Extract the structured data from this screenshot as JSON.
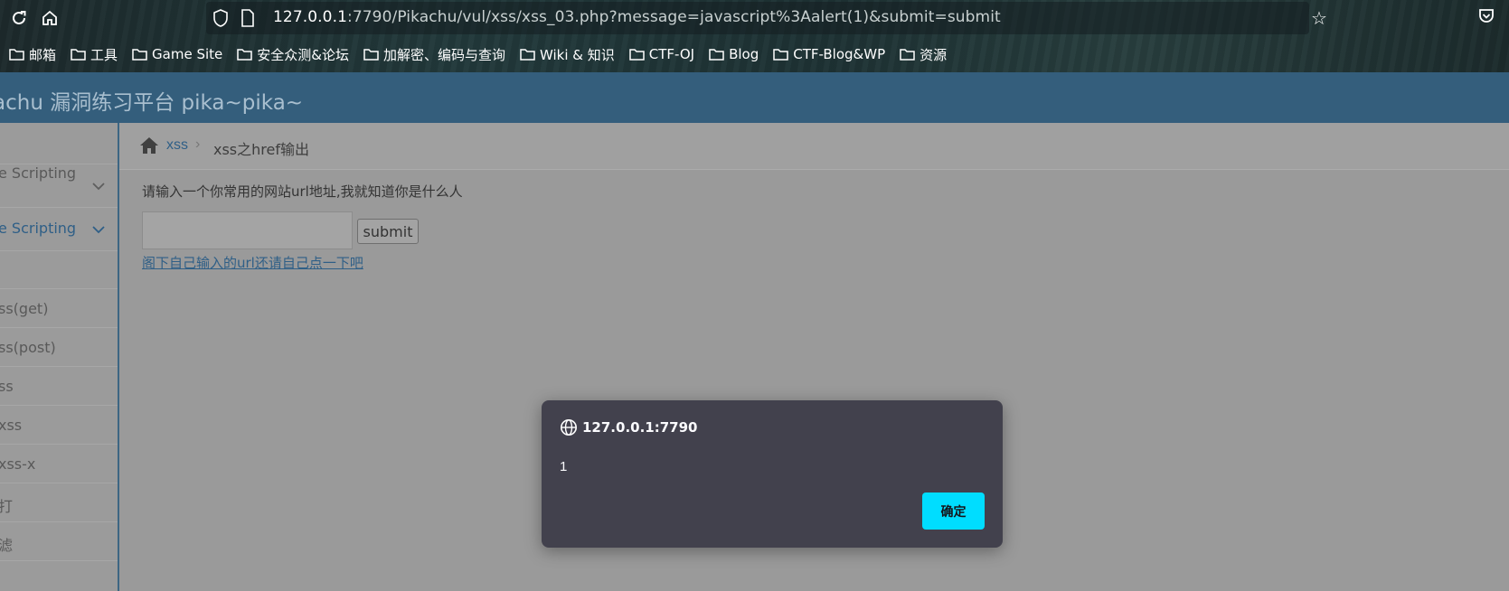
{
  "browser": {
    "url_host": "127.0.0.1",
    "url_rest": ":7790/Pikachu/vul/xss/xss_03.php?message=javascript%3Aalert(1)&submit=submit",
    "icons": [
      "reload-icon",
      "home-icon",
      "shield-icon",
      "page-icon",
      "star-icon",
      "pocket-icon"
    ]
  },
  "bookmarks": [
    {
      "label": "邮箱"
    },
    {
      "label": "工具"
    },
    {
      "label": "Game Site"
    },
    {
      "label": "安全众测&论坛"
    },
    {
      "label": "加解密、编码与查询"
    },
    {
      "label": "Wiki & 知识"
    },
    {
      "label": "CTF-OJ"
    },
    {
      "label": "Blog"
    },
    {
      "label": "CTF-Blog&WP"
    },
    {
      "label": "资源"
    }
  ],
  "header": {
    "title": "achu 漏洞练习平台 pika~pika~"
  },
  "sidebar": {
    "items": [
      {
        "label": ""
      },
      {
        "label": "e Scripting"
      },
      {
        "label": ""
      },
      {
        "label": "ss(get)"
      },
      {
        "label": "ss(post)"
      },
      {
        "label": "ss"
      },
      {
        "label": "xss"
      },
      {
        "label": "xss-x"
      },
      {
        "label": "打"
      },
      {
        "label": "滤"
      }
    ]
  },
  "breadcrumb": {
    "link": "xss",
    "separator": "›",
    "current": "xss之href输出"
  },
  "main": {
    "prompt": "请输入一个你常用的网站url地址,我就知道你是什么人",
    "input_value": "",
    "submit_label": "submit",
    "result_link": "阁下自己输入的url还请自己点一下吧"
  },
  "dialog": {
    "origin": "127.0.0.1:7790",
    "message": "1",
    "ok_label": "确定"
  },
  "colors": {
    "header": "#345e7c",
    "dialog_bg": "#42414d",
    "dialog_button": "#00ddff",
    "link": "#2f5f87"
  }
}
